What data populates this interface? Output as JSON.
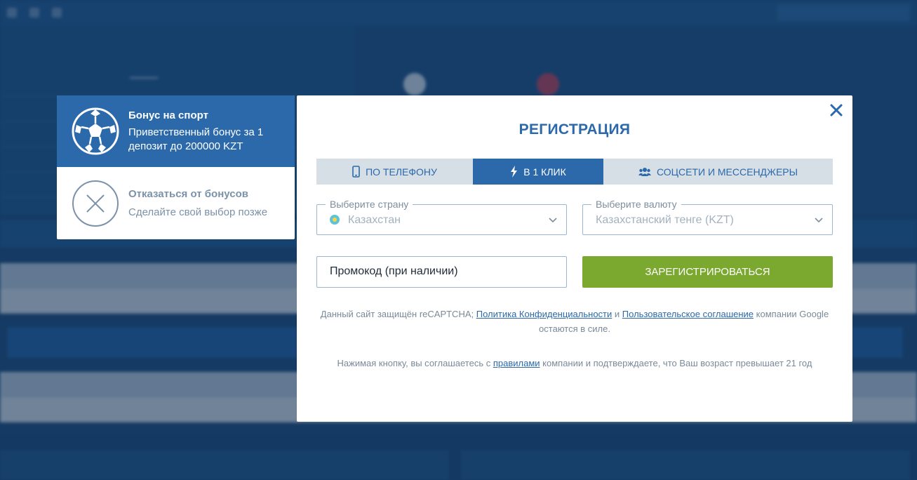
{
  "modal": {
    "title": "РЕГИСТРАЦИЯ",
    "tabs": [
      {
        "label": "ПО ТЕЛЕФОНУ",
        "icon": "phone-icon",
        "active": false
      },
      {
        "label": "В 1 КЛИК",
        "icon": "lightning-icon",
        "active": true
      },
      {
        "label": "СОЦСЕТИ И МЕССЕНДЖЕРЫ",
        "icon": "users-icon",
        "active": false
      }
    ],
    "country": {
      "label": "Выберите страну",
      "value": "Казахстан"
    },
    "currency": {
      "label": "Выберите валюту",
      "value": "Казахстанский тенге (KZT)"
    },
    "promo_placeholder": "Промокод (при наличии)",
    "submit_label": "ЗАРЕГИСТРИРОВАТЬСЯ",
    "recaptcha": {
      "prefix": "Данный сайт защищён reCAPTCHA;",
      "privacy_link": "Политика Конфиденциальности",
      "and": "и",
      "terms_link": "Пользовательское соглашение",
      "suffix": "компании Google остаются в силе."
    },
    "agreement": {
      "prefix": "Нажимая кнопку, вы соглашаетесь с",
      "rules_link": "правилами",
      "suffix": "компании и подтверждаете, что Ваш возраст превышает 21 год"
    }
  },
  "bonus": {
    "sport": {
      "title": "Бонус на спорт",
      "text": "Приветственный бонус за 1 депозит до 200000 KZT",
      "icon": "soccer-ball-icon"
    },
    "decline": {
      "title": "Отказаться от бонусов",
      "text": "Сделайте свой выбор позже",
      "icon": "close-circle-icon"
    }
  },
  "colors": {
    "primary": "#2b69ab",
    "submit": "#7ba82e",
    "overlay": "#1c4a7a"
  }
}
